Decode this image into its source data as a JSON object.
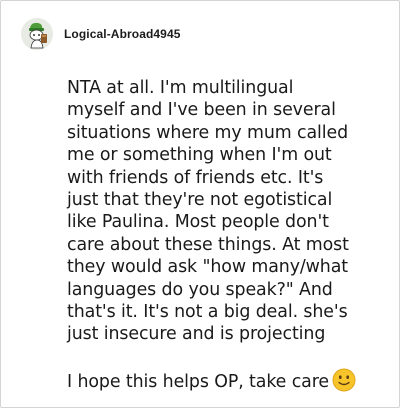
{
  "post": {
    "author": "Logical-Abroad4945",
    "avatar_icon": "snoo-avatar-icon",
    "body_main": "NTA at all. I'm multilingual\nmyself and I've been in several\nsituations where my mum called\nme or something when I'm out\nwith friends of friends etc. It's\njust that they're not egotistical\nlike Paulina. Most people don't\ncare about these things. At most\nthey would ask \"how many/what\nlanguages do you speak?\" And\nthat's it. It's not a big deal. she's\njust insecure and is projecting\n\nI hope this helps OP, take care",
    "emoji_icon": "slightly-smiling-face-icon"
  },
  "colors": {
    "text": "#1a1a1a",
    "border": "#d4d4d4",
    "emoji": "#f7c52b"
  }
}
